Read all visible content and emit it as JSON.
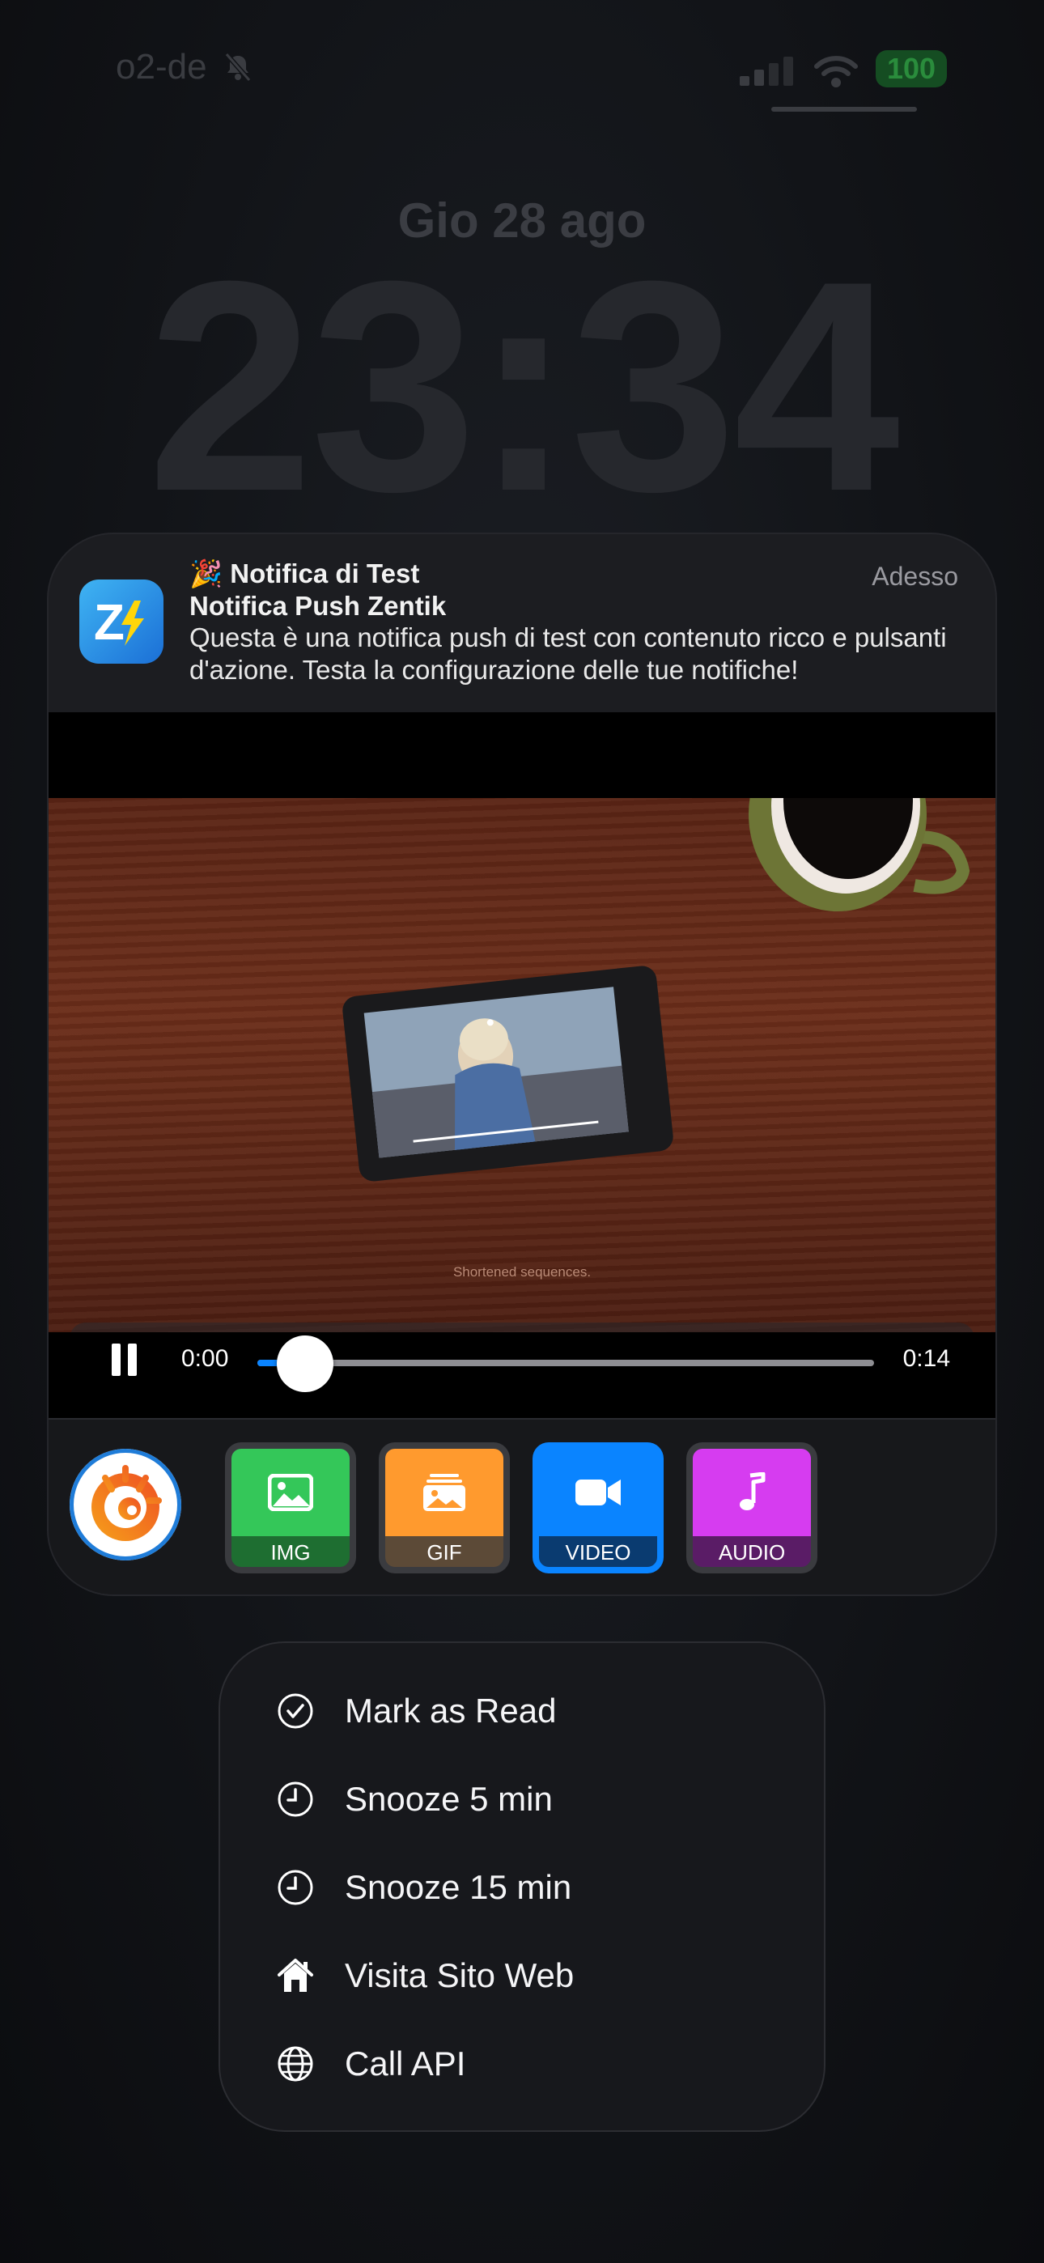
{
  "status_bar": {
    "carrier": "o2-de",
    "battery": "100",
    "colors": {
      "battery_bg": "#154d22",
      "battery_text": "#2a8c3c"
    }
  },
  "lock_screen": {
    "date": "Gio 28 ago",
    "time": "23:34"
  },
  "notification": {
    "app_icon": "zentik-app-icon",
    "title": "🎉 Notifica di Test",
    "subtitle": "Notifica Push Zentik",
    "body": "Questa è una notifica push di test con contenuto ricco e pulsanti d'azione. Testa la configurazione delle tue notifiche!",
    "time": "Adesso"
  },
  "video_player": {
    "caption": "Shortened sequences.",
    "current_time": "0:00",
    "duration": "0:14",
    "progress_fraction": 0.0,
    "state": "playing",
    "accent_color": "#0a84ff"
  },
  "attachments": {
    "avatar_icon": "grafana-logo-icon",
    "tiles": [
      {
        "label": "IMG",
        "icon": "image-icon",
        "color": "#34c759",
        "selected": false
      },
      {
        "label": "GIF",
        "icon": "gif-icon",
        "color": "#ff9a2e",
        "selected": false
      },
      {
        "label": "VIDEO",
        "icon": "video-camera-icon",
        "color": "#0a84ff",
        "selected": true
      },
      {
        "label": "AUDIO",
        "icon": "music-note-icon",
        "color": "#d63cf0",
        "selected": false
      }
    ]
  },
  "actions": {
    "items": [
      {
        "label": "Mark as Read",
        "icon": "checkmark-circle-icon"
      },
      {
        "label": "Snooze 5 min",
        "icon": "clock-icon"
      },
      {
        "label": "Snooze 15 min",
        "icon": "clock-icon"
      },
      {
        "label": "Visita Sito Web",
        "icon": "house-icon"
      },
      {
        "label": "Call API",
        "icon": "globe-icon"
      }
    ]
  }
}
